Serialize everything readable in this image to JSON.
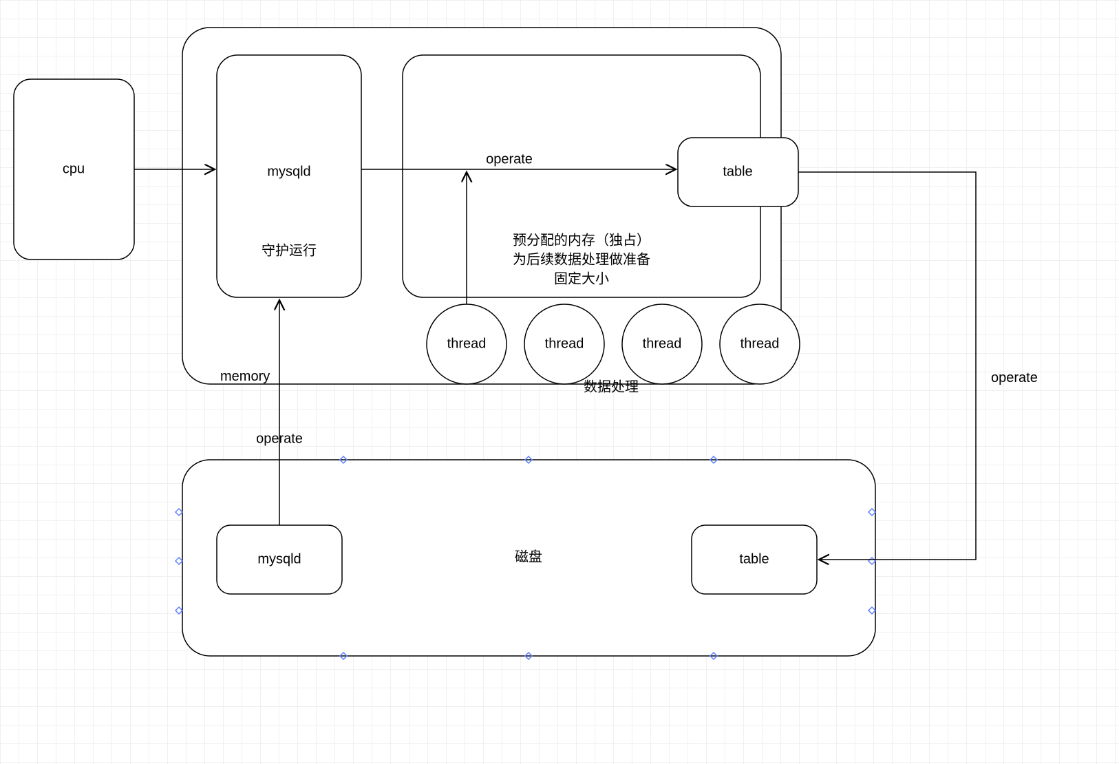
{
  "nodes": {
    "cpu": "cpu",
    "memory": "memory",
    "mysqld_mem": "mysqld",
    "mysqld_mem_sub": "守护运行",
    "innodb_container_lines": [
      "预分配的内存（独占）",
      "为后续数据处理做准备",
      "固定大小"
    ],
    "table_mem": "table",
    "threads": [
      "thread",
      "thread",
      "thread",
      "thread"
    ],
    "threads_caption": "数据处理",
    "disk": "磁盘",
    "mysqld_disk": "mysqld",
    "table_disk": "table"
  },
  "edges": {
    "cpu_to_mysqld": "",
    "mysqld_to_table": "operate",
    "thread_to_mysqld": "",
    "table_to_disk_table": "operate",
    "mysqld_disk_to_mysqld": "operate"
  }
}
